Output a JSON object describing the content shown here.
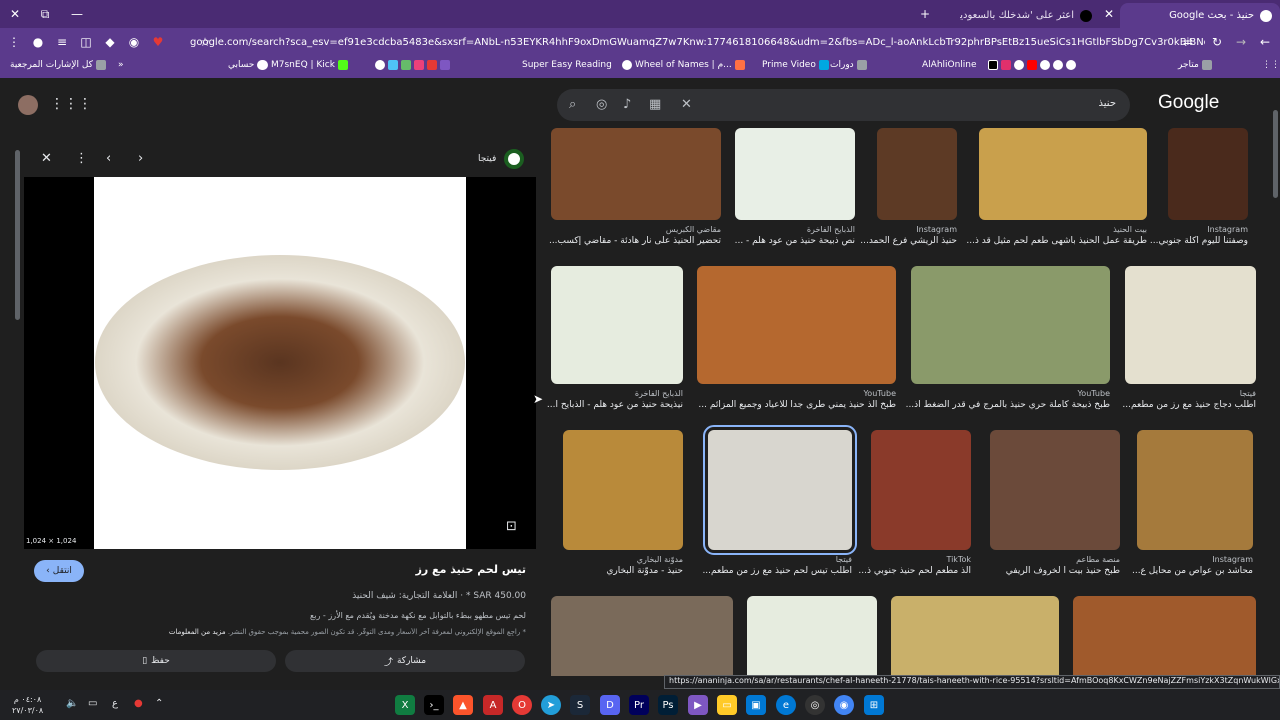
{
  "tabs": [
    {
      "title": "حنيذ - بحث Google"
    },
    {
      "title": "اعثر على 'شدخلك بالسعودية' علا"
    }
  ],
  "omnibox": {
    "url": "google.com/search?sca_esv=ef91e3cdcba5483e&sxsrf=ANbL-n53EYKR4hhF9oxDmGWuamqZ7w7Knw:1774618106648&udm=2&fbs=ADc_l-aoAnkLcbTr92phrBPsEtBz15ueSiCs1HGtlbFSbDg7Cv3r0kBiBNc6ZC_EZ50aiB7_ffbLHEZYBDF..."
  },
  "bookmarks": [
    {
      "label": "كل الإشارات المرجعية"
    },
    {
      "label": "حسابي"
    },
    {
      "label": "M7snEQ | Kick"
    },
    {
      "label": "Super Easy Reading"
    },
    {
      "label": "Wheel of Names | م..."
    },
    {
      "label": "Prime Video"
    },
    {
      "label": "دورات"
    },
    {
      "label": "AlAhliOnline"
    },
    {
      "label": "متاجر"
    }
  ],
  "search": {
    "query": "حنيذ"
  },
  "logo": "Google",
  "viewer": {
    "source": "فيتجا",
    "dims": "1,024 × 1,024",
    "visit": "انتقل",
    "title": "تيس لحم حنيذ مع رز",
    "price": "SAR 450.00 *",
    "brand": "العلامة التجارية: شيف الحنيذ",
    "desc": "لحم تيس مطهو ببطء بالتوابل مع نكهة مدخنة ويُقدم مع الأرز - ربع",
    "note": "* راجِع الموقع الإلكتروني لمعرفة آخر الأسعار ومدى التوفّر. قد تكون الصور محمية بموجب حقوق النشر.",
    "more": "مزيد من المعلومات",
    "save": "حفظ",
    "share": "مشاركة"
  },
  "results": [
    {
      "src": "مقاضي الكبريس",
      "title": "تحضير الحنيذ على نار هادئة - مقاضي إكسب..."
    },
    {
      "src": "الذبايح الفاخرة",
      "title": "نص ذبيحة حنيذ من عود هلم - ..."
    },
    {
      "src": "Instagram",
      "title": "حنيذ الريشي فرع الحمد..."
    },
    {
      "src": "بيت الحنيذ",
      "title": "طريقة عمل الحنيذ بأشهى طعم لحم مثيل قد ذ..."
    },
    {
      "src": "Instagram",
      "title": "وصفتنا لليوم أكلة جنوبي..."
    },
    {
      "src": "الذبايح الفاخرة",
      "title": "نيذيحة حنيذ من عود هلم - الذبايح ا..."
    },
    {
      "src": "YouTube",
      "title": "طبخ الذ حنيذ يمني طرى جداً للاعياد وجميع المزائم ..."
    },
    {
      "src": "YouTube",
      "title": "طبخ ذبيحة كاملة حري حنيذ بالمرج في قدر الضغط اذ..."
    },
    {
      "src": "فيتجا",
      "title": "اطلب دجاج حنيذ مع رز من مطعم..."
    },
    {
      "src": "مدوّنة البخاري",
      "title": "حنيذ - مدوّنة البخاري"
    },
    {
      "src": "فيتجا",
      "title": "اطلب تيس لحم حنيذ مع رز من مطعم..."
    },
    {
      "src": "TikTok",
      "title": "الذ مطعم لحم حنيذ جنوبي ذ..."
    },
    {
      "src": "منصة مطاعم",
      "title": "طبخ حنيذ بيت ا لخروف الريفي"
    },
    {
      "src": "Instagram",
      "title": "محاشد بن عواص من محايل ع..."
    }
  ],
  "status_url": "https://ananinja.com/sa/ar/restaurants/chef-al-haneeth-21778/tais-haneeth-with-rice-95514?srsltid=AfmBOoq8KxCWZn9eNajZZFmsiYzkX3tZqnWukWlGxEoclg6gvHMYEA",
  "taskbar": {
    "time": "٠٤:٠٨ م",
    "date": "٢٧/٠٣/٠٨"
  },
  "colors": {
    "tabstrip": "#4a2b73",
    "toolbar": "#5b3a8c",
    "page": "#1f1f1f",
    "accent": "#8ab4f8"
  }
}
